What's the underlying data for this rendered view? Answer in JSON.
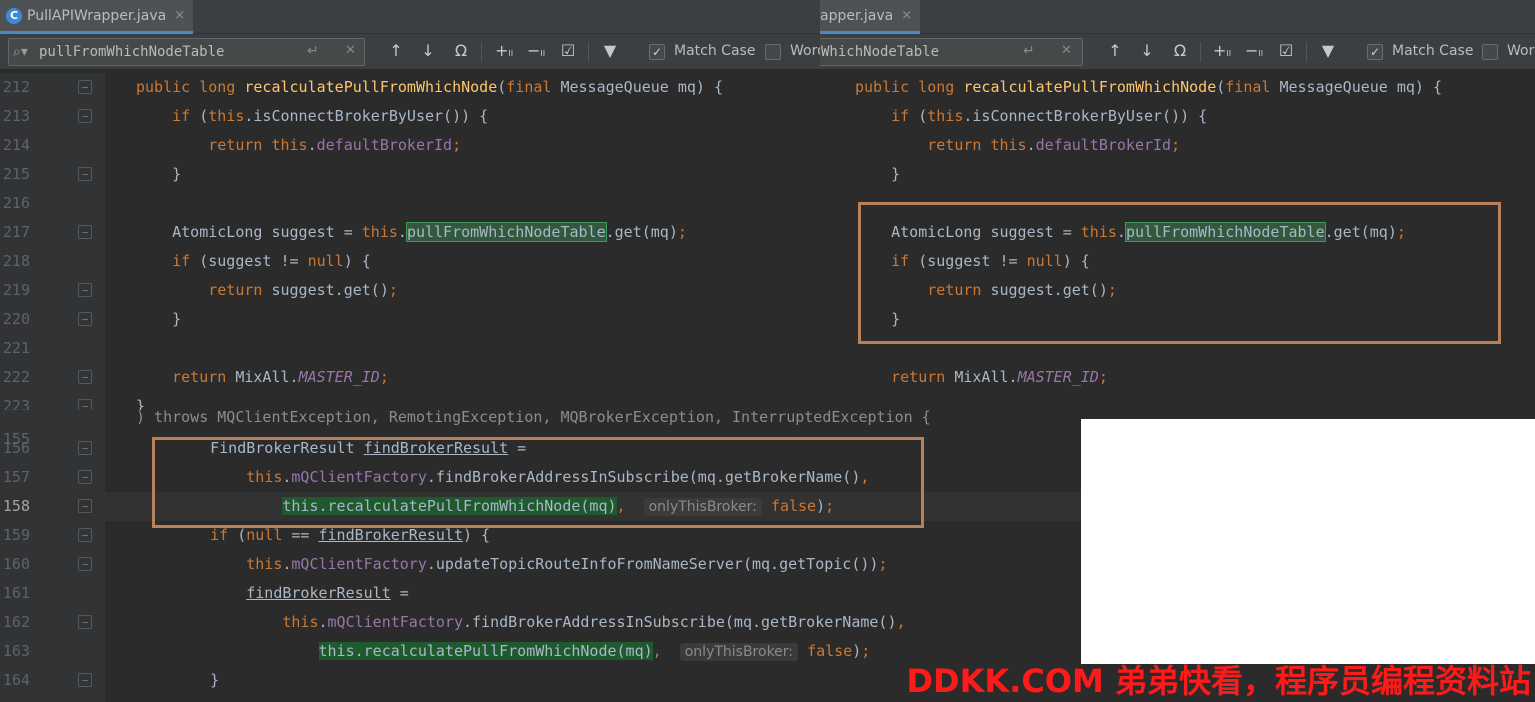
{
  "left_tab": {
    "title": "PullAPIWrapper.java",
    "icon": "c-class-icon",
    "close": "×"
  },
  "right_tab": {
    "title": "apper.java",
    "close": "×"
  },
  "find_left": {
    "query": "pullFromWhichNodeTable",
    "match_case": "Match Case",
    "word": "Word"
  },
  "find_right": {
    "query": "WhichNodeTable",
    "match_case": "Match Case",
    "word": "Wor"
  },
  "editor_top_left": {
    "lines": [
      {
        "n": "212",
        "segments": [
          [
            "kw",
            "public"
          ],
          [
            "t",
            " "
          ],
          [
            "kw",
            "long"
          ],
          [
            "t",
            " "
          ],
          [
            "mth",
            "recalculatePullFromWhichNode"
          ],
          [
            "t",
            "("
          ],
          [
            "kw",
            "final"
          ],
          [
            "t",
            " MessageQueue mq) {"
          ]
        ]
      },
      {
        "n": "213",
        "segments": [
          [
            "t",
            "    "
          ],
          [
            "kw",
            "if"
          ],
          [
            "t",
            " ("
          ],
          [
            "kw",
            "this"
          ],
          [
            "t",
            ".isConnectBrokerByUser()) {"
          ]
        ]
      },
      {
        "n": "214",
        "segments": [
          [
            "t",
            "        "
          ],
          [
            "kw",
            "return"
          ],
          [
            "t",
            " "
          ],
          [
            "kw",
            "this"
          ],
          [
            "t",
            "."
          ],
          [
            "fld",
            "defaultBrokerId"
          ],
          [
            "kw",
            ";"
          ]
        ]
      },
      {
        "n": "215",
        "segments": [
          [
            "t",
            "    }"
          ]
        ]
      },
      {
        "n": "216",
        "segments": []
      },
      {
        "n": "217",
        "segments": [
          [
            "t",
            "    AtomicLong suggest = "
          ],
          [
            "kw",
            "this"
          ],
          [
            "t",
            "."
          ],
          [
            "hlbox",
            "pullFromWhichNodeTable"
          ],
          [
            "t",
            ".get(mq)"
          ],
          [
            "kw",
            ";"
          ]
        ]
      },
      {
        "n": "218",
        "segments": [
          [
            "t",
            "    "
          ],
          [
            "kw",
            "if"
          ],
          [
            "t",
            " (suggest != "
          ],
          [
            "kw",
            "null"
          ],
          [
            "t",
            ") {"
          ]
        ]
      },
      {
        "n": "219",
        "segments": [
          [
            "t",
            "        "
          ],
          [
            "kw",
            "return"
          ],
          [
            "t",
            " suggest.get()"
          ],
          [
            "kw",
            ";"
          ]
        ]
      },
      {
        "n": "220",
        "segments": [
          [
            "t",
            "    }"
          ]
        ]
      },
      {
        "n": "221",
        "segments": []
      },
      {
        "n": "222",
        "segments": [
          [
            "t",
            "    "
          ],
          [
            "kw",
            "return"
          ],
          [
            "t",
            " MixAll."
          ],
          [
            "stat",
            "MASTER_ID"
          ],
          [
            "kw",
            ";"
          ]
        ]
      },
      {
        "n": "223",
        "segments": [
          [
            "t",
            "}"
          ]
        ]
      }
    ]
  },
  "editor_bottom": {
    "partial_line": ") throws MQClientException, RemotingException, MQBrokerException, InterruptedException {",
    "lines": [
      {
        "n": "156",
        "segments": [
          [
            "t",
            "    FindBrokerResult "
          ],
          [
            "und",
            "findBrokerResult"
          ],
          [
            "t",
            " ="
          ]
        ]
      },
      {
        "n": "157",
        "segments": [
          [
            "t",
            "        "
          ],
          [
            "kw",
            "this"
          ],
          [
            "t",
            "."
          ],
          [
            "fld",
            "mQClientFactory"
          ],
          [
            "t",
            ".findBrokerAddressInSubscribe(mq.getBrokerName()"
          ],
          [
            "kw",
            ","
          ]
        ]
      },
      {
        "n": "158",
        "segments": [
          [
            "t",
            "            "
          ],
          [
            "hlgreen",
            "this.recalculatePullFromWhichNode(mq)"
          ],
          [
            "kw",
            ","
          ],
          [
            "t",
            "  "
          ],
          [
            "hint",
            "onlyThisBroker:"
          ],
          [
            "t",
            " "
          ],
          [
            "kw",
            "false"
          ],
          [
            "t",
            ")"
          ],
          [
            "kw",
            ";"
          ]
        ]
      },
      {
        "n": "159",
        "segments": [
          [
            "t",
            "    "
          ],
          [
            "kw",
            "if"
          ],
          [
            "t",
            " ("
          ],
          [
            "kw",
            "null"
          ],
          [
            "t",
            " == "
          ],
          [
            "und",
            "findBrokerResult"
          ],
          [
            "t",
            ") {"
          ]
        ]
      },
      {
        "n": "160",
        "segments": [
          [
            "t",
            "        "
          ],
          [
            "kw",
            "this"
          ],
          [
            "t",
            "."
          ],
          [
            "fld",
            "mQClientFactory"
          ],
          [
            "t",
            ".updateTopicRouteInfoFromNameServer(mq.getTopic())"
          ],
          [
            "kw",
            ";"
          ]
        ]
      },
      {
        "n": "161",
        "segments": [
          [
            "t",
            "        "
          ],
          [
            "und",
            "findBrokerResult"
          ],
          [
            "t",
            " ="
          ]
        ]
      },
      {
        "n": "162",
        "segments": [
          [
            "t",
            "            "
          ],
          [
            "kw",
            "this"
          ],
          [
            "t",
            "."
          ],
          [
            "fld",
            "mQClientFactory"
          ],
          [
            "t",
            ".findBrokerAddressInSubscribe(mq.getBrokerName()"
          ],
          [
            "kw",
            ","
          ]
        ]
      },
      {
        "n": "163",
        "segments": [
          [
            "t",
            "                "
          ],
          [
            "hlgreen",
            "this.recalculatePullFromWhichNode(mq)"
          ],
          [
            "kw",
            ","
          ],
          [
            "t",
            "  "
          ],
          [
            "hint",
            "onlyThisBroker:"
          ],
          [
            "t",
            " "
          ],
          [
            "kw",
            "false"
          ],
          [
            "t",
            ")"
          ],
          [
            "kw",
            ";"
          ]
        ]
      },
      {
        "n": "164",
        "segments": [
          [
            "t",
            "    }"
          ]
        ]
      }
    ]
  },
  "editor_top_right": {
    "lines": [
      {
        "segments": [
          [
            "kw",
            "public"
          ],
          [
            "t",
            " "
          ],
          [
            "kw",
            "long"
          ],
          [
            "t",
            " "
          ],
          [
            "mth",
            "recalculatePullFromWhichNode"
          ],
          [
            "t",
            "("
          ],
          [
            "kw",
            "final"
          ],
          [
            "t",
            " MessageQueue mq) {"
          ]
        ]
      },
      {
        "segments": [
          [
            "t",
            "    "
          ],
          [
            "kw",
            "if"
          ],
          [
            "t",
            " ("
          ],
          [
            "kw",
            "this"
          ],
          [
            "t",
            ".isConnectBrokerByUser()) {"
          ]
        ]
      },
      {
        "segments": [
          [
            "t",
            "        "
          ],
          [
            "kw",
            "return"
          ],
          [
            "t",
            " "
          ],
          [
            "kw",
            "this"
          ],
          [
            "t",
            "."
          ],
          [
            "fld",
            "defaultBrokerId"
          ],
          [
            "kw",
            ";"
          ]
        ]
      },
      {
        "segments": [
          [
            "t",
            "    }"
          ]
        ]
      },
      {
        "segments": []
      },
      {
        "segments": [
          [
            "t",
            "    AtomicLong suggest = "
          ],
          [
            "kw",
            "this"
          ],
          [
            "t",
            "."
          ],
          [
            "hlbox",
            "pullFromWhichNodeTable"
          ],
          [
            "t",
            ".get(mq)"
          ],
          [
            "kw",
            ";"
          ]
        ]
      },
      {
        "segments": [
          [
            "t",
            "    "
          ],
          [
            "kw",
            "if"
          ],
          [
            "t",
            " (suggest != "
          ],
          [
            "kw",
            "null"
          ],
          [
            "t",
            ") {"
          ]
        ]
      },
      {
        "segments": [
          [
            "t",
            "        "
          ],
          [
            "kw",
            "return"
          ],
          [
            "t",
            " suggest.get()"
          ],
          [
            "kw",
            ";"
          ]
        ]
      },
      {
        "segments": [
          [
            "t",
            "    }"
          ]
        ]
      },
      {
        "segments": []
      },
      {
        "segments": [
          [
            "t",
            "    "
          ],
          [
            "kw",
            "return"
          ],
          [
            "t",
            " MixAll."
          ],
          [
            "stat",
            "MASTER_ID"
          ],
          [
            "kw",
            ";"
          ]
        ]
      }
    ]
  },
  "watermark": "DDKK.COM 弟弟快看，程序员编程资料站",
  "colors": {
    "annotation_box": "#b9815a",
    "watermark": "#ff1a1a",
    "editor_bg": "#2b2b2b"
  }
}
